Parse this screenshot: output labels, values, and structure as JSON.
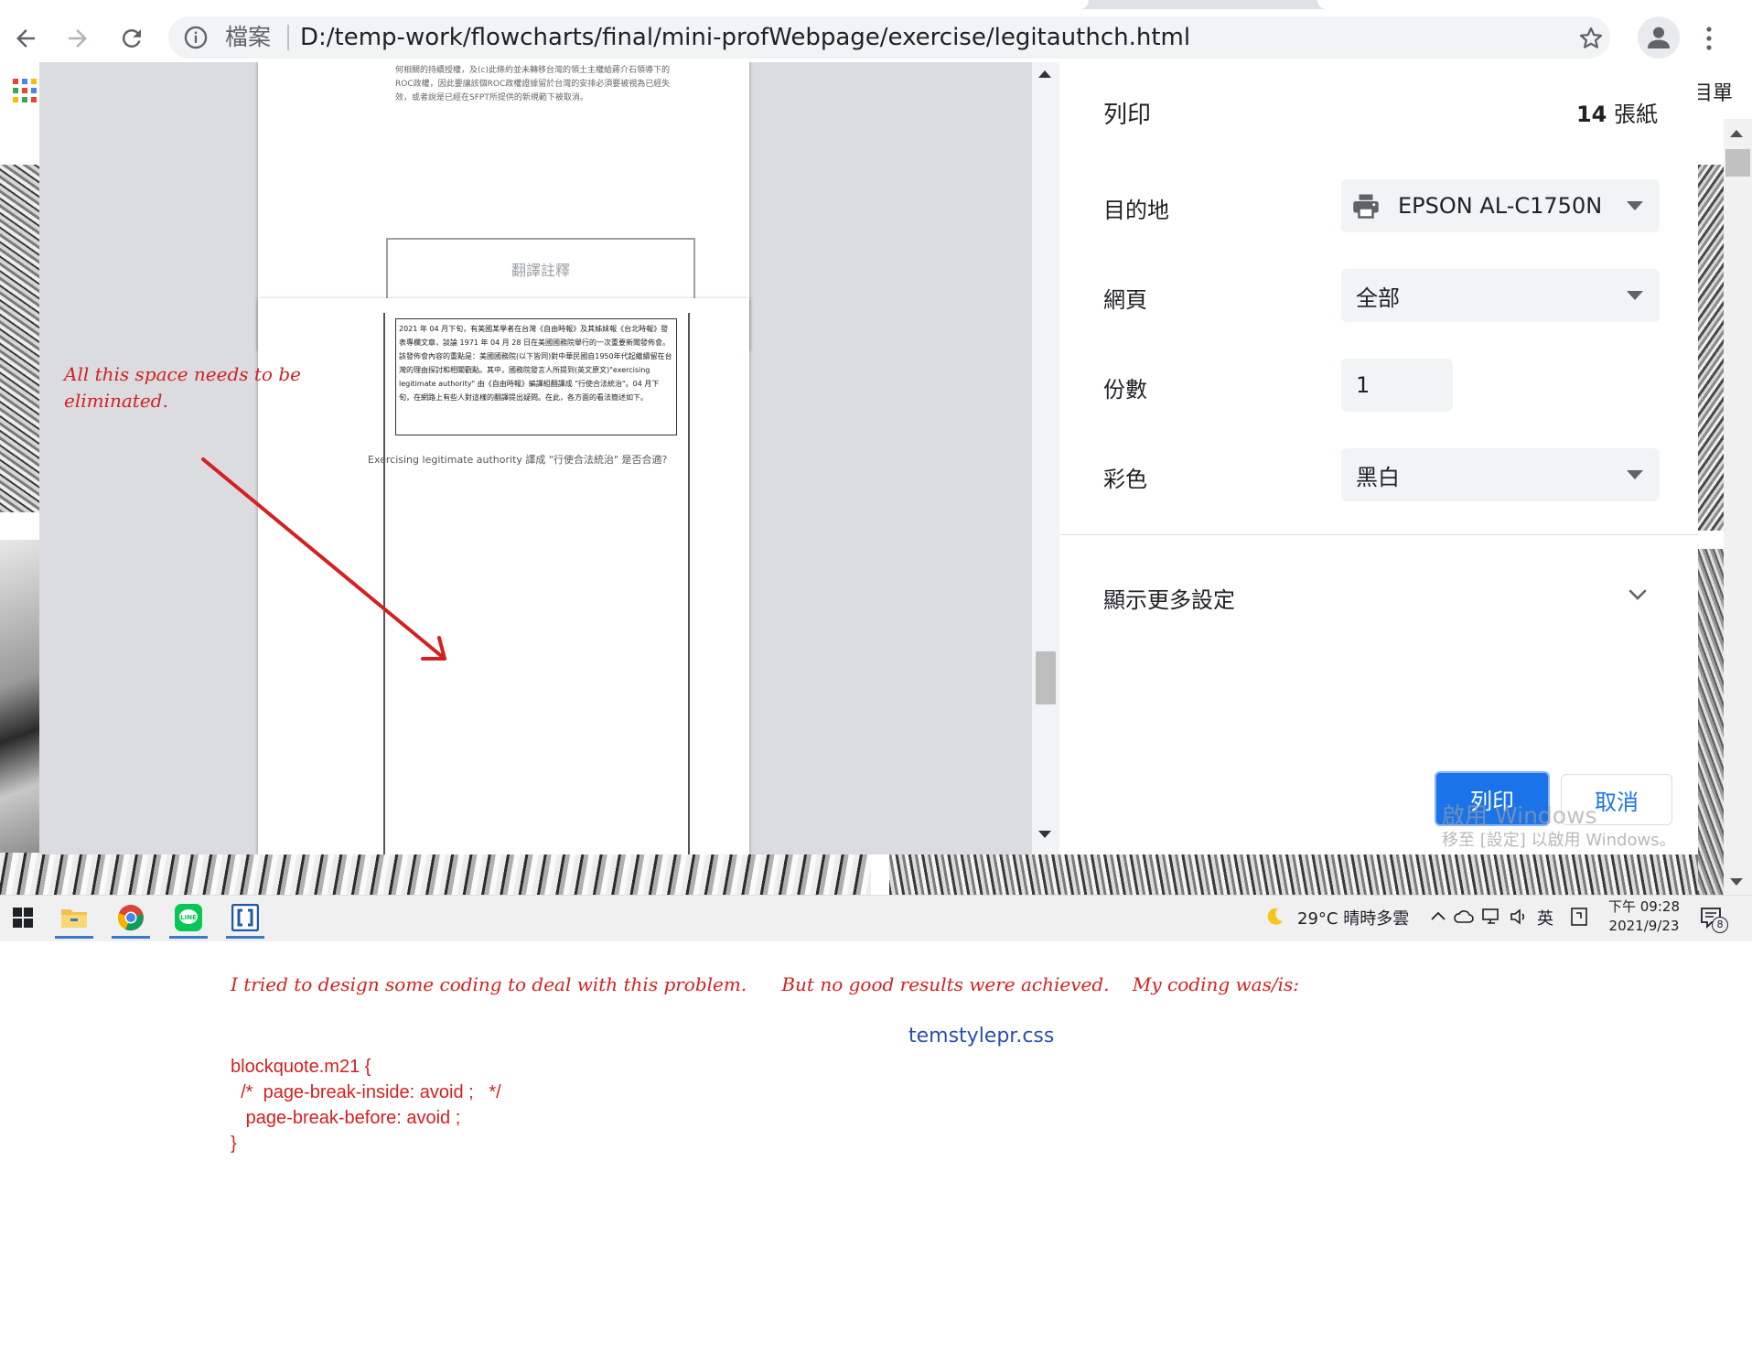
{
  "browser": {
    "file_label": "檔案",
    "url": "D:/temp-work/flowcharts/final/mini-profWebpage/exercise/legitauthch.html",
    "bookmark_tail": "目單",
    "icons": [
      "back-icon",
      "forward-icon",
      "reload-icon",
      "info-icon",
      "star-icon",
      "profile-icon",
      "menu-icon",
      "apps-icon"
    ]
  },
  "preview": {
    "sheet1_text": "何相關的持續授權，及(c)此條約並未轉移台灣的領土主權給蔣介石領導下的ROC政權，因此要讓該個ROC政權證據留於台灣的安排必須要被視為已經失效，或者說是已經在SFPT所提供的新規範下被取消。",
    "footnote_label": "翻譯註釋",
    "article_text": "2021 年 04 月下旬，有美國某學者在台灣《自由時報》及其姊妹報《台北時報》發表專欄文章，談論 1971 年 04 月 28 日在美國國務院舉行的一次重要新聞發佈會。該發佈會內容的重點是：美國國務院(以下皆同)對中華民國自1950年代起繼續留在台灣的理由探討和相關觀點。其中，國務院發言人所提到(英文原文)\"exercising legitimate authority\" 由《自由時報》編譯組翻譯成 \"行使合法統治\"。04 月下旬，在網路上有些人對這樣的翻譯提出疑問。在此，各方面的看法簡述如下。",
    "question": "Exercising legitimate authority 譯成 \"行使合法統治\" 是否合適?"
  },
  "annotation": {
    "space_note": "All this space needs to be eliminated."
  },
  "settings": {
    "title": "列印",
    "sheet_count_number": "14",
    "sheet_count_unit": " 張紙",
    "destination_label": "目的地",
    "destination_value": "EPSON AL-C1750N",
    "pages_label": "網頁",
    "pages_value": "全部",
    "copies_label": "份數",
    "copies_value": "1",
    "color_label": "彩色",
    "color_value": "黑白",
    "more_settings": "顯示更多設定",
    "print_button": "列印",
    "cancel_button": "取消"
  },
  "watermark": {
    "title": "啟用 Windows",
    "subtitle": "移至 [設定] 以啟用 Windows。"
  },
  "taskbar": {
    "apps": [
      "windows-start-icon",
      "file-explorer-icon",
      "chrome-icon",
      "line-icon",
      "brackets-icon"
    ],
    "weather": "29°C  晴時多雲",
    "ime": "英",
    "time": "下午 09:28",
    "date": "2021/9/23",
    "notification_count": "8"
  },
  "notes": {
    "bottom_note": "I tried to design some coding to deal with this problem.      But no good results were achieved.    My coding was/is:",
    "css_filename": "temstylepr.css",
    "code": "blockquote.m21 {\n  /*  page-break-inside: avoid ;   */\n   page-break-before: avoid ;\n}"
  },
  "colors": {
    "accent": "#1a73e8",
    "annotation_red": "#d42020",
    "link_blue": "#2a4fb0"
  }
}
